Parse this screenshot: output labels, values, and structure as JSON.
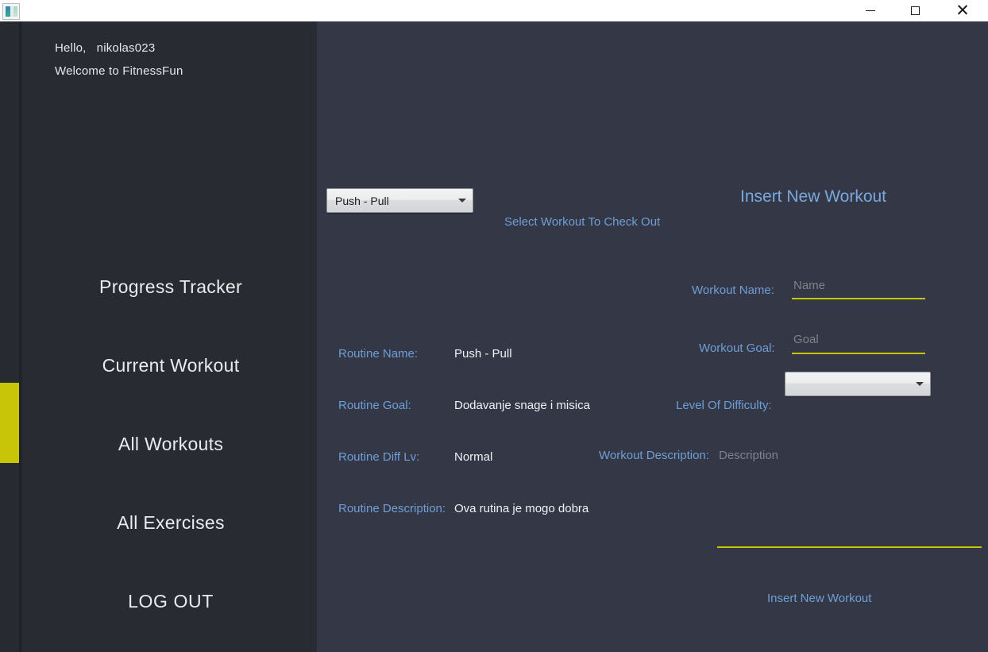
{
  "window": {
    "app_icon": "app-logo-icon",
    "controls": {
      "minimize": "minimize-icon",
      "maximize": "maximize-icon",
      "close": "close-icon"
    }
  },
  "sidebar": {
    "greeting_line1": "Hello,   nikolas023",
    "greeting_line2": "Welcome to FitnessFun",
    "active_index": 2,
    "items": [
      {
        "label": "Progress Tracker"
      },
      {
        "label": "Current Workout"
      },
      {
        "label": "All Workouts"
      },
      {
        "label": "All Exercises"
      },
      {
        "label": "LOG OUT"
      }
    ]
  },
  "main": {
    "workout_select": {
      "value": "Push - Pull",
      "caption": "Select Workout To Check Out",
      "arrow_icon": "chevron-down-icon"
    },
    "routine_details": {
      "fields": [
        {
          "label": "Routine Name:",
          "value": "Push - Pull"
        },
        {
          "label": "Routine Goal:",
          "value": "Dodavanje snage i misica"
        },
        {
          "label": "Routine Diff Lv:",
          "value": "Normal"
        },
        {
          "label": "Routine Description:",
          "value": "Ova rutina je mogo dobra"
        }
      ]
    },
    "insert_form": {
      "title": "Insert New Workout",
      "name_label": "Workout Name:",
      "name_placeholder": "Name",
      "name_value": "",
      "goal_label": "Workout Goal:",
      "goal_placeholder": "Goal",
      "goal_value": "",
      "difficulty_label": "Level Of Difficulty:",
      "difficulty_value": "",
      "difficulty_arrow_icon": "chevron-down-icon",
      "description_label": "Workout Description:",
      "description_placeholder": "Description",
      "description_value": "",
      "submit_label": "Insert New Workout"
    }
  },
  "colors": {
    "sidebar_bg": "#282b32",
    "content_bg": "#343846",
    "accent_yellow": "#c8c408",
    "accent_blue": "#6e9ed6",
    "title_blue": "#7aa7dd",
    "text_primary": "#f0f1f3",
    "placeholder": "#7f828b"
  }
}
